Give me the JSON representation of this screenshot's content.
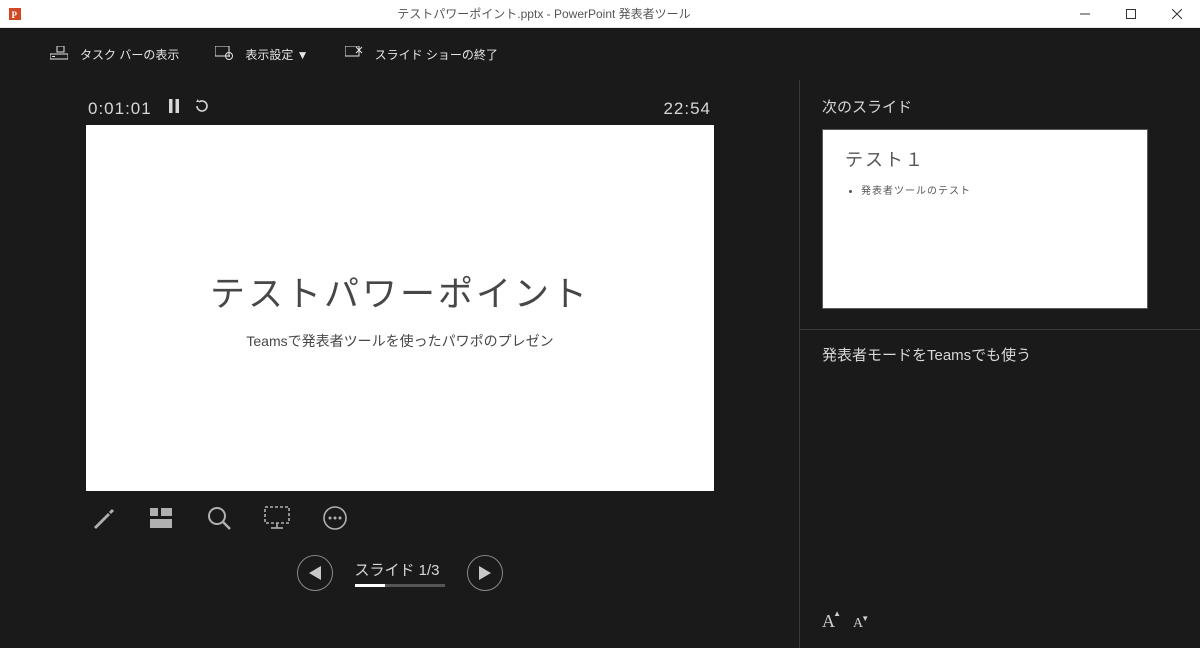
{
  "window": {
    "title": "テストパワーポイント.pptx - PowerPoint 発表者ツール"
  },
  "toolbar": {
    "show_taskbar": "タスク バーの表示",
    "display_settings": "表示設定 ▼",
    "end_show": "スライド ショーの終了"
  },
  "timer": {
    "elapsed": "0:01:01",
    "clock": "22:54"
  },
  "current_slide": {
    "title": "テストパワーポイント",
    "subtitle": "Teamsで発表者ツールを使ったパワポのプレゼン"
  },
  "nav": {
    "counter": "スライド 1/3"
  },
  "right_panel": {
    "next_label": "次のスライド",
    "next_slide_title": "テスト１",
    "next_slide_bullet": "発表者ツールのテスト",
    "notes": "発表者モードをTeamsでも使う"
  }
}
